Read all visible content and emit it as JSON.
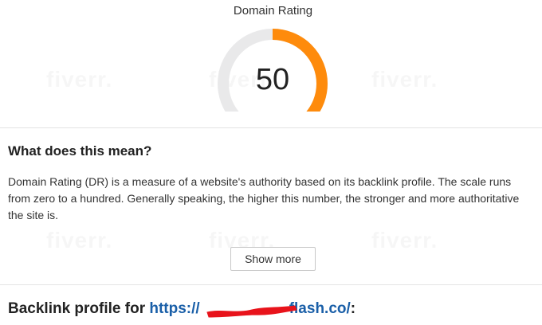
{
  "gauge": {
    "title": "Domain Rating",
    "value": "50",
    "fraction": 0.5,
    "track_color": "#e9e9ea",
    "fill_color": "#fe8b0c"
  },
  "explanation": {
    "heading": "What does this mean?",
    "body": "Domain Rating (DR) is a measure of a website's authority based on its backlink profile. The scale runs from zero to a hundred. Generally speaking, the higher this number, the stronger and more authoritative the site is.",
    "show_more_label": "Show more"
  },
  "backlinks": {
    "heading_prefix": "Backlink profile for ",
    "url_start": "https://",
    "url_end": "flash.co/",
    "heading_suffix": ":",
    "redaction_color": "#e8131b"
  },
  "watermark": {
    "text": "fiverr."
  }
}
